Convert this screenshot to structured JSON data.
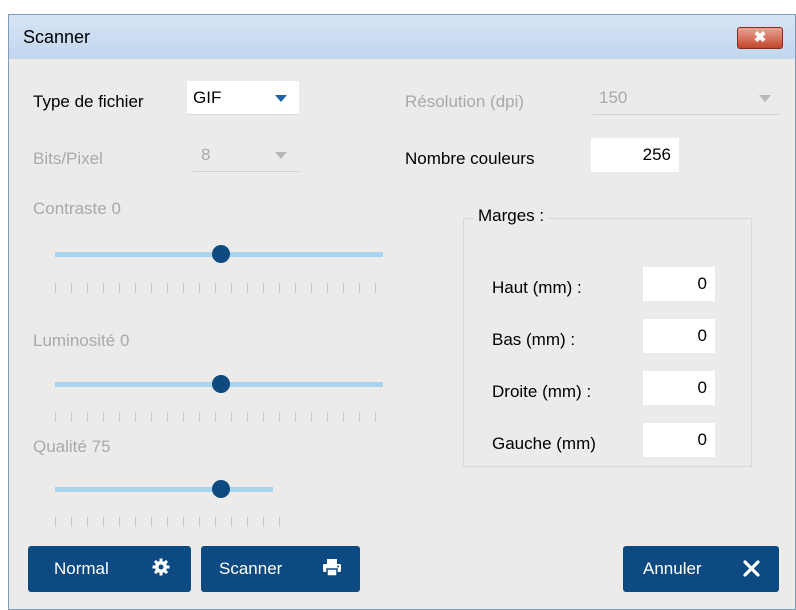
{
  "window": {
    "title": "Scanner",
    "close_glyph": "✖"
  },
  "file_type": {
    "label": "Type de fichier",
    "value": "GIF"
  },
  "resolution": {
    "label": "Résolution (dpi)",
    "value": "150"
  },
  "bits_pixel": {
    "label": "Bits/Pixel",
    "value": "8"
  },
  "color_count": {
    "label": "Nombre couleurs",
    "value": "256"
  },
  "contrast": {
    "label": "Contraste",
    "value": "0"
  },
  "brightness": {
    "label": "Luminosité",
    "value": "0"
  },
  "quality": {
    "label": "Qualité",
    "value": "75"
  },
  "margins": {
    "title": "Marges :",
    "top": {
      "label": "Haut (mm) :",
      "value": "0"
    },
    "bottom": {
      "label": "Bas (mm) :",
      "value": "0"
    },
    "right": {
      "label": "Droite (mm) :",
      "value": "0"
    },
    "left": {
      "label": "Gauche (mm)",
      "value": "0"
    }
  },
  "buttons": {
    "normal": {
      "label": "Normal",
      "icon": "gear-icon"
    },
    "scan": {
      "label": "Scanner",
      "icon": "printer-icon"
    },
    "cancel": {
      "label": "Annuler",
      "icon": "close-icon"
    }
  },
  "colors": {
    "accent": "#0d4a82",
    "track": "#a8d4f0",
    "disabled_text": "#a9a9a9"
  }
}
